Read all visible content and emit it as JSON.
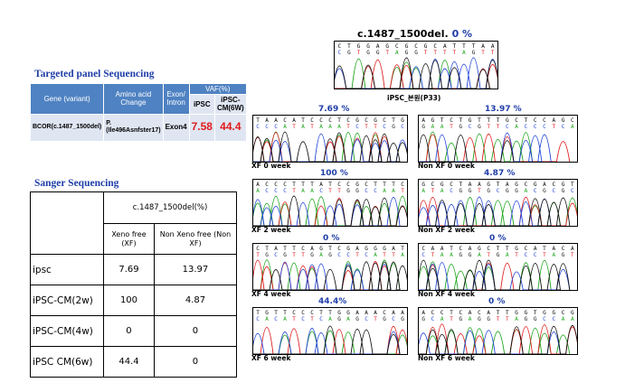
{
  "targeted_panel": {
    "title": "Targeted panel Sequencing",
    "headers": {
      "gene": "Gene (variant)",
      "amino": "Amino acid Change",
      "exon": "Exon/ Intron",
      "vaf": "VAF(%)",
      "ipsc": "iPSC",
      "ipsc_cm": "iPSC- CM(6W)"
    },
    "row": {
      "gene": "BCOR(c.1487_1500del)",
      "amino": "P.(Ile496Asnfster17)",
      "exon": "Exon4",
      "ipsc": "7.58",
      "ipsc_cm": "44.4"
    }
  },
  "sanger": {
    "title": "Sanger Sequencing",
    "header": "c.1487_1500del(%)",
    "col_xf": "Xeno free (XF)",
    "col_nonxf": "Non Xeno free (Non XF)",
    "rows": [
      {
        "label": "ipsc",
        "xf": "7.69",
        "nonxf": "13.97"
      },
      {
        "label": "iPSC-CM(2w)",
        "xf": "100",
        "nonxf": "4.87"
      },
      {
        "label": "iPSC-CM(4w)",
        "xf": "0",
        "nonxf": "0"
      },
      {
        "label": "iPSC CM(6w)",
        "xf": "44.4",
        "nonxf": "0"
      }
    ]
  },
  "chromatograms": {
    "main": {
      "title": "c.1487_1500del.",
      "pct": "0 %",
      "caption": "iPSC_본원(P33)"
    },
    "panels": [
      {
        "id": "xf0",
        "pct": "7.69 %",
        "caption": "XF 0 week"
      },
      {
        "id": "nonxf0",
        "pct": "13.97 %",
        "caption": "Non XF 0 week"
      },
      {
        "id": "xf2",
        "pct": "100 %",
        "caption": "XF 2 week"
      },
      {
        "id": "nonxf2",
        "pct": "4.87 %",
        "caption": "Non XF 2 week"
      },
      {
        "id": "xf4",
        "pct": "0 %",
        "caption": "XF 4 week"
      },
      {
        "id": "nonxf4",
        "pct": "0 %",
        "caption": "Non XF 4 week"
      },
      {
        "id": "xf6",
        "pct": "44.4%",
        "caption": "XF 6 week"
      },
      {
        "id": "nonxf6",
        "pct": "0 %",
        "caption": "Non XF 6 week"
      }
    ],
    "colors": {
      "A": "#1aa31a",
      "T": "#e01b1b",
      "C": "#2446d8",
      "G": "#111111"
    }
  }
}
